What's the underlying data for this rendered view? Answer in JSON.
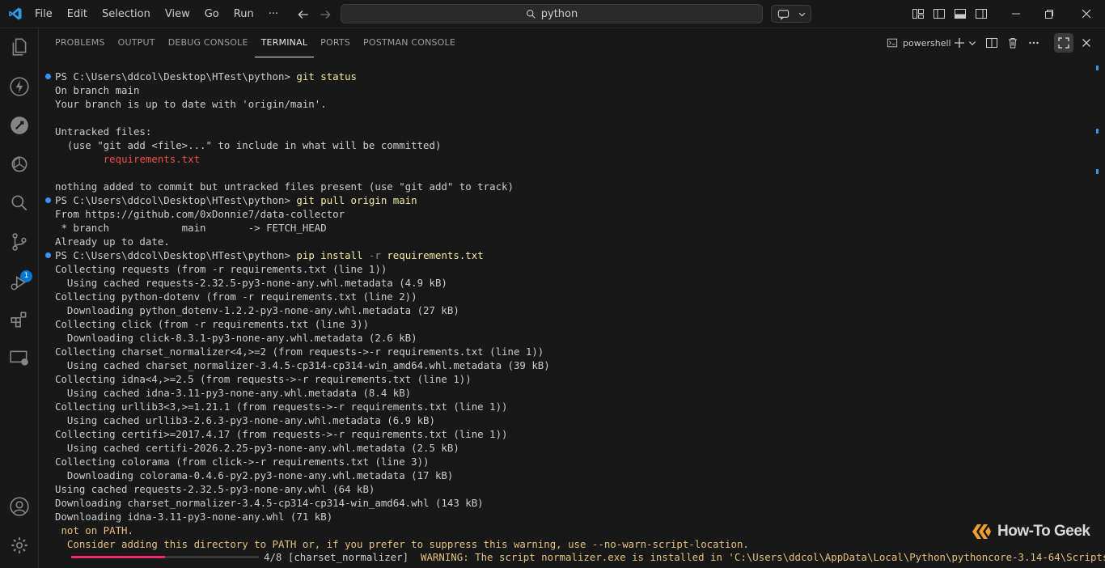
{
  "colors": {
    "accent": "#0078d4",
    "command": "#f1e8a0",
    "error": "#f14c4c",
    "warning": "#e5c07b",
    "progress": "#f92672"
  },
  "menu": [
    "File",
    "Edit",
    "Selection",
    "View",
    "Go",
    "Run",
    "···"
  ],
  "search": {
    "text": "python"
  },
  "activity": {
    "source_control_badge": "1"
  },
  "panel": {
    "tabs": [
      "PROBLEMS",
      "OUTPUT",
      "DEBUG CONSOLE",
      "TERMINAL",
      "PORTS",
      "POSTMAN CONSOLE"
    ],
    "active_tab": "TERMINAL",
    "shell": "powershell"
  },
  "terminal": {
    "lines": [
      {
        "dot": true,
        "segs": [
          {
            "t": "PS C:\\Users\\ddcol\\Desktop\\HTest\\python> "
          },
          {
            "t": "git status",
            "c": "cmd"
          }
        ]
      },
      {
        "segs": [
          {
            "t": "On branch main"
          }
        ]
      },
      {
        "segs": [
          {
            "t": "Your branch is up to date with 'origin/main'."
          }
        ]
      },
      {
        "segs": [
          {
            "t": ""
          }
        ]
      },
      {
        "segs": [
          {
            "t": "Untracked files:"
          }
        ]
      },
      {
        "segs": [
          {
            "t": "  (use \"git add <file>...\" to include in what will be committed)"
          }
        ]
      },
      {
        "segs": [
          {
            "t": "        "
          },
          {
            "t": "requirements.txt",
            "c": "red"
          }
        ]
      },
      {
        "segs": [
          {
            "t": ""
          }
        ]
      },
      {
        "segs": [
          {
            "t": "nothing added to commit but untracked files present (use \"git add\" to track)"
          }
        ]
      },
      {
        "dot": true,
        "segs": [
          {
            "t": "PS C:\\Users\\ddcol\\Desktop\\HTest\\python> "
          },
          {
            "t": "git pull origin main",
            "c": "cmd"
          }
        ]
      },
      {
        "segs": [
          {
            "t": "From https://github.com/0xDonnie7/data-collector"
          }
        ]
      },
      {
        "segs": [
          {
            "t": " * branch            main       -> FETCH_HEAD"
          }
        ]
      },
      {
        "segs": [
          {
            "t": "Already up to date."
          }
        ]
      },
      {
        "dot": true,
        "segs": [
          {
            "t": "PS C:\\Users\\ddcol\\Desktop\\HTest\\python> "
          },
          {
            "t": "pip install ",
            "c": "cmd"
          },
          {
            "t": "-r",
            "c": "flag"
          },
          {
            "t": " requirements.txt",
            "c": "cmd"
          }
        ]
      },
      {
        "segs": [
          {
            "t": "Collecting requests (from -r requirements.txt (line 1))"
          }
        ]
      },
      {
        "segs": [
          {
            "t": "  Using cached requests-2.32.5-py3-none-any.whl.metadata (4.9 kB)"
          }
        ]
      },
      {
        "segs": [
          {
            "t": "Collecting python-dotenv (from -r requirements.txt (line 2))"
          }
        ]
      },
      {
        "segs": [
          {
            "t": "  Downloading python_dotenv-1.2.2-py3-none-any.whl.metadata (27 kB)"
          }
        ]
      },
      {
        "segs": [
          {
            "t": "Collecting click (from -r requirements.txt (line 3))"
          }
        ]
      },
      {
        "segs": [
          {
            "t": "  Downloading click-8.3.1-py3-none-any.whl.metadata (2.6 kB)"
          }
        ]
      },
      {
        "segs": [
          {
            "t": "Collecting charset_normalizer<4,>=2 (from requests->-r requirements.txt (line 1))"
          }
        ]
      },
      {
        "segs": [
          {
            "t": "  Using cached charset_normalizer-3.4.5-cp314-cp314-win_amd64.whl.metadata (39 kB)"
          }
        ]
      },
      {
        "segs": [
          {
            "t": "Collecting idna<4,>=2.5 (from requests->-r requirements.txt (line 1))"
          }
        ]
      },
      {
        "segs": [
          {
            "t": "  Using cached idna-3.11-py3-none-any.whl.metadata (8.4 kB)"
          }
        ]
      },
      {
        "segs": [
          {
            "t": "Collecting urllib3<3,>=1.21.1 (from requests->-r requirements.txt (line 1))"
          }
        ]
      },
      {
        "segs": [
          {
            "t": "  Using cached urllib3-2.6.3-py3-none-any.whl.metadata (6.9 kB)"
          }
        ]
      },
      {
        "segs": [
          {
            "t": "Collecting certifi>=2017.4.17 (from requests->-r requirements.txt (line 1))"
          }
        ]
      },
      {
        "segs": [
          {
            "t": "  Using cached certifi-2026.2.25-py3-none-any.whl.metadata (2.5 kB)"
          }
        ]
      },
      {
        "segs": [
          {
            "t": "Collecting colorama (from click->-r requirements.txt (line 3))"
          }
        ]
      },
      {
        "segs": [
          {
            "t": "  Downloading colorama-0.4.6-py2.py3-none-any.whl.metadata (17 kB)"
          }
        ]
      },
      {
        "segs": [
          {
            "t": "Using cached requests-2.32.5-py3-none-any.whl (64 kB)"
          }
        ]
      },
      {
        "segs": [
          {
            "t": "Downloading charset_normalizer-3.4.5-cp314-cp314-win_amd64.whl (143 kB)"
          }
        ]
      },
      {
        "segs": [
          {
            "t": "Downloading idna-3.11-py3-none-any.whl (71 kB)"
          }
        ]
      },
      {
        "segs": [
          {
            "t": " not on PATH.",
            "c": "yel"
          }
        ]
      },
      {
        "segs": [
          {
            "t": "  Consider adding this directory to PATH or, if you prefer to suppress this warning, use --no-warn-script-location.",
            "c": "yel"
          }
        ]
      }
    ],
    "progress": {
      "fraction": 0.5,
      "count": "4/8",
      "package": "[charset_normalizer]",
      "warning": "WARNING: The script normalizer.exe is installed in 'C:\\Users\\ddcol\\AppData\\Local\\Python\\pythoncore-3.14-64\\Scripts' whic"
    }
  },
  "watermark": {
    "text": "How-To Geek"
  }
}
